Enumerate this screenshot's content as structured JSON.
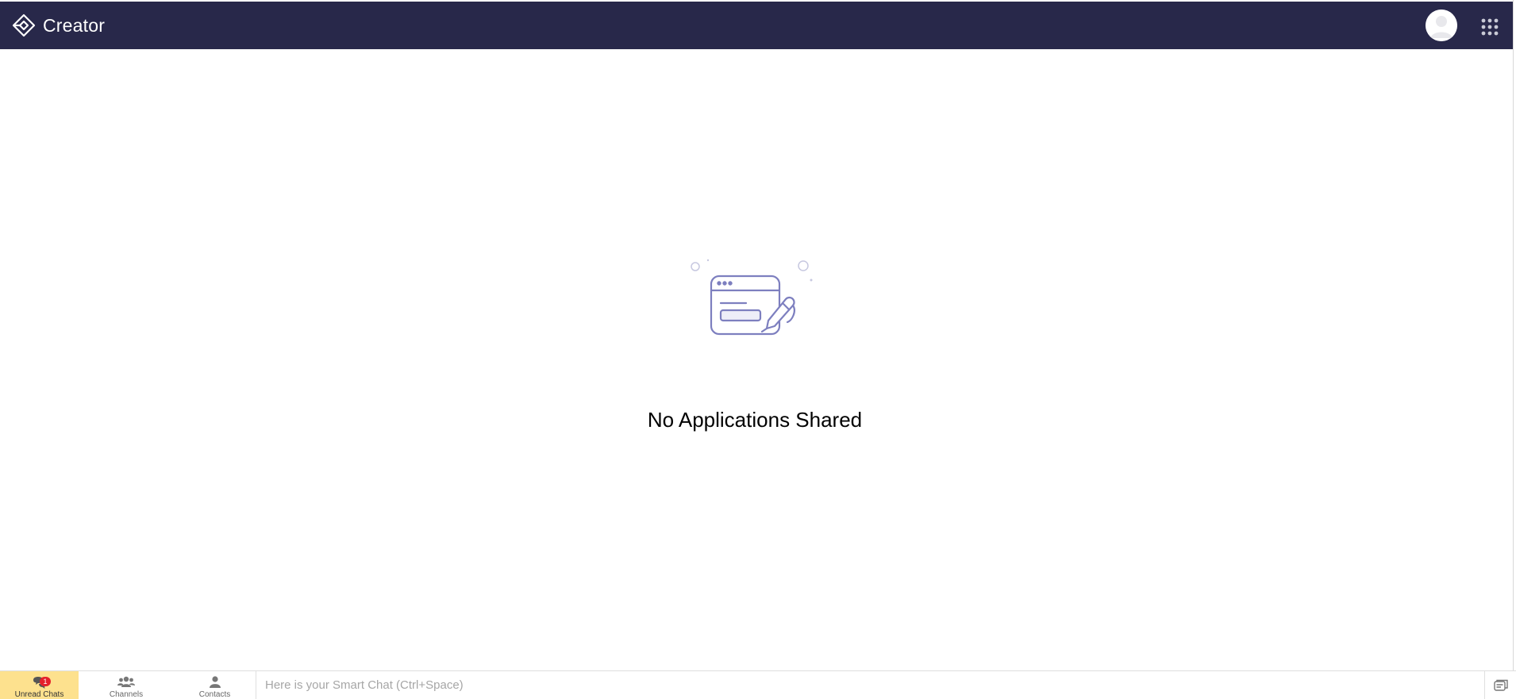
{
  "app": {
    "name": "Creator",
    "logo_icon": "creator-logo-icon",
    "header_color": "#28284a"
  },
  "header": {
    "avatar_icon": "user-avatar",
    "apps_menu_icon": "app-grid-icon"
  },
  "main": {
    "empty_state_icon": "app-form-with-pen-illustration",
    "empty_message": "No Applications Shared"
  },
  "chatbar": {
    "tabs": [
      {
        "label": "Unread Chats",
        "icon": "chat-bubbles-icon",
        "badge": "1",
        "active": true
      },
      {
        "label": "Channels",
        "icon": "group-icon"
      },
      {
        "label": "Contacts",
        "icon": "person-icon"
      }
    ],
    "input_placeholder": "Here is your Smart Chat (Ctrl+Space)",
    "right_icon": "chat-window-icon",
    "active_tab_color": "#fde18e",
    "badge_color": "#e4212b"
  }
}
